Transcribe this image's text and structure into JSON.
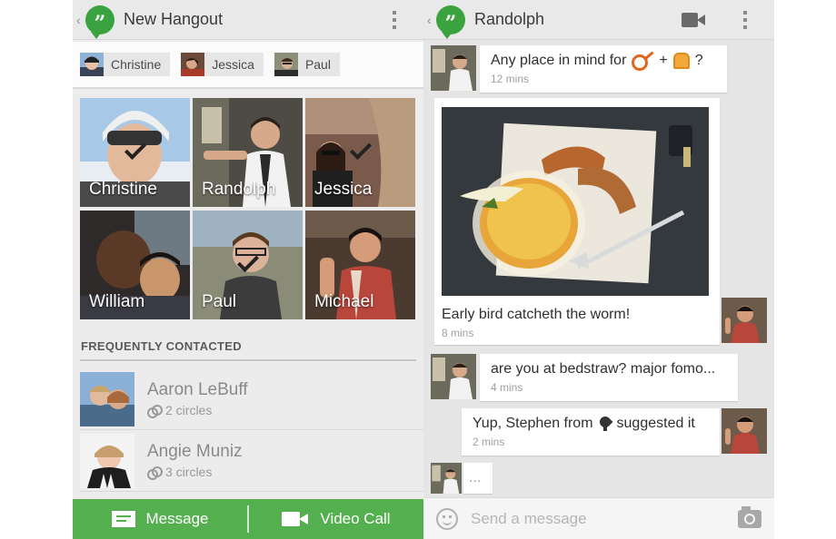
{
  "left": {
    "header": {
      "back": "‹",
      "title": "New Hangout"
    },
    "chips": [
      {
        "label": "Christine"
      },
      {
        "label": "Jessica"
      },
      {
        "label": "Paul"
      }
    ],
    "tiles": [
      {
        "name": "Christine",
        "selected": true
      },
      {
        "name": "Randolph",
        "selected": false
      },
      {
        "name": "Jessica",
        "selected": true
      },
      {
        "name": "William",
        "selected": false
      },
      {
        "name": "Paul",
        "selected": true
      },
      {
        "name": "Michael",
        "selected": false
      }
    ],
    "section_title": "FREQUENTLY CONTACTED",
    "contacts": [
      {
        "name": "Aaron LeBuff",
        "circles": "2 circles"
      },
      {
        "name": "Angie Muniz",
        "circles": "3 circles"
      }
    ],
    "bottom": {
      "message_label": "Message",
      "video_label": "Video Call"
    }
  },
  "right": {
    "header": {
      "back": "‹",
      "title": "Randolph"
    },
    "messages": [
      {
        "text": "Any place in mind for",
        "plus": "+",
        "question": "?",
        "time": "12 mins"
      },
      {
        "text": "Early bird catcheth the worm!",
        "time": "8 mins"
      },
      {
        "text": "are you at bedstraw? major fomo...",
        "time": "4 mins"
      },
      {
        "text": "Yup, Stephen from",
        "suffix": "suggested it",
        "time": "2 mins"
      },
      {
        "text": "..."
      }
    ],
    "composer": {
      "placeholder": "Send a message"
    }
  },
  "colors": {
    "accent_green": "#54b04f",
    "logo_green": "#3aa33f"
  }
}
